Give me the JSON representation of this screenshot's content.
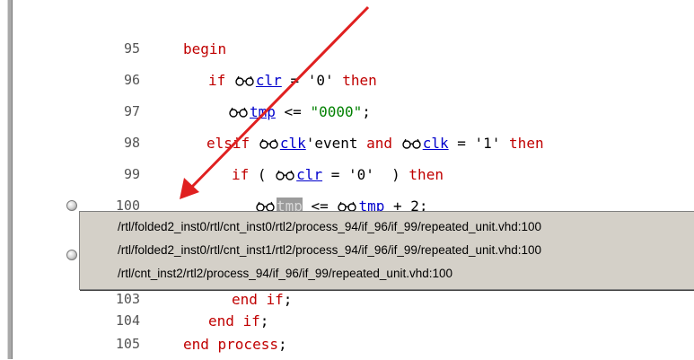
{
  "editor": {
    "lines": [
      {
        "num": "95"
      },
      {
        "num": "96"
      },
      {
        "num": "97"
      },
      {
        "num": "98"
      },
      {
        "num": "99"
      },
      {
        "num": "100"
      },
      {
        "num": "103"
      },
      {
        "num": "104"
      },
      {
        "num": "105"
      }
    ],
    "tokens": {
      "begin": "begin",
      "if": "if",
      "then": "then",
      "elsif": "elsif",
      "and": "and",
      "end_if": "end if",
      "end_process": "end process",
      "clr": "clr",
      "tmp": "tmp",
      "clk": "clk",
      "eq_zero": " = '0' ",
      "assign_0000_op": " <= ",
      "str_0000": "\"0000\"",
      "semicolon": ";",
      "event": "'event ",
      "eq_one": " = '1' ",
      "paren_open": " ( ",
      "paren_close": " ) ",
      "assign": " <= ",
      "plus_two": " + 2;"
    },
    "annotation_icon": "glasses-icon",
    "colors": {
      "keyword": "#c00000",
      "string": "#008000",
      "signal": "#0000cc",
      "arrow": "#e02020"
    }
  },
  "tooltip": {
    "paths": [
      "/rtl/folded2_inst0/rtl/cnt_inst0/rtl2/process_94/if_96/if_99/repeated_unit.vhd:100",
      "/rtl/folded2_inst0/rtl/cnt_inst1/rtl2/process_94/if_96/if_99/repeated_unit.vhd:100",
      "/rtl/cnt_inst2/rtl2/process_94/if_96/if_99/repeated_unit.vhd:100"
    ]
  }
}
